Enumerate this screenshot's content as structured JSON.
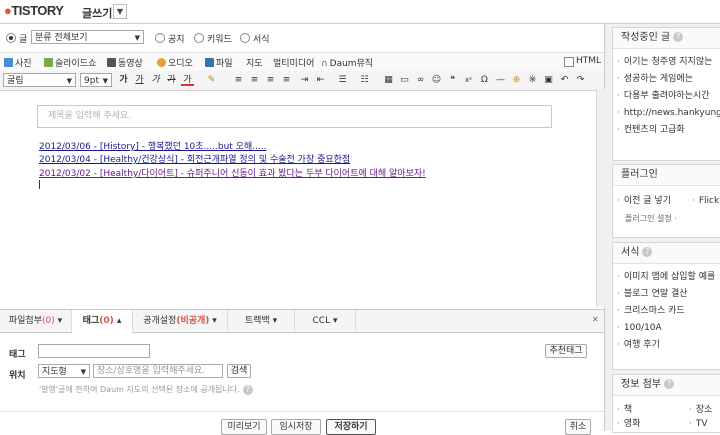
{
  "app": {
    "logo": "TISTORY",
    "subtitle": "글쓰기",
    "dropdown": "▼"
  },
  "category": {
    "radio_category_label": "글",
    "select_value": "분류 전체보기",
    "radio_notice": "공지",
    "radio_keyword": "키워드",
    "radio_form": "서식"
  },
  "attach_bar": {
    "photo": "사진",
    "slideshow": "슬라이드쇼",
    "video": "동영상",
    "audio": "오디오",
    "file": "파일",
    "map": "지도",
    "multimedia": "멀티미디어",
    "daum_music": "Daum뮤직",
    "html_label": "HTML"
  },
  "format_bar": {
    "font": "굴림",
    "size": "9pt",
    "bold": "가",
    "underline": "가",
    "italic": "가",
    "strike": "가",
    "color": "가"
  },
  "editor": {
    "title_placeholder": "제목을 입력해 주세요.",
    "links": [
      {
        "text": "2012/03/06 - [History] - 행복했던 10초.....but 오해.....",
        "color": "#1a1a8e"
      },
      {
        "text": "2012/03/04 - [Healthy/건강상식] - 회전근개파열 정의 및 수술전 가장 중요한점",
        "color": "#1a1a8e"
      },
      {
        "text": "2012/03/02 - [Healthy/다이어트] - 슈퍼주니어 신동이 효과 봤다는 두부 다이어트에 대해 알아보자!",
        "color": "#6a1a8e"
      }
    ]
  },
  "bottom_tabs": {
    "file_attach": "파일첨부",
    "file_attach_count": "(0)",
    "tag": "태그",
    "tag_count": "(0)",
    "visibility": "공개설정",
    "visibility_value": "(비공개)",
    "trackback": "트랙백",
    "ccl": "CCL"
  },
  "tag_section": {
    "tag_label": "태그",
    "location_label": "위치",
    "recommend_button": "추천태그",
    "map_select": "지도형",
    "place_placeholder": "장소/상호명을 입력해주세요.",
    "search_button": "검색",
    "notice": "'발행'글에 한하여 Daum 지도의 선택된 장소에 공개됩니다."
  },
  "actions": {
    "preview": "미리보기",
    "temp_save": "임시저장",
    "save": "저장하기",
    "cancel": "취소"
  },
  "sidebar": {
    "writing_title": "작성중인 글",
    "writing_items": [
      "이기는 청주영 지지않는",
      "성공하는 게임에는",
      "다용부 출려야하는시간",
      "http://news.hankyung",
      "컨텐츠의 고급화"
    ],
    "plugin_title": "플러그인",
    "plugin_items": [
      "이전 글 넣기",
      "Flickr"
    ],
    "plugin_settings": "플러그인 설정",
    "form_title": "서식",
    "form_items": [
      "이미지 맵에 삽입할 예를",
      "블로그 연말 결산",
      "크리스마스 카드",
      "100/10A",
      "여행 후기"
    ],
    "info_title": "정보 첨부",
    "info_items": [
      "책",
      "장소",
      "영화",
      "TV"
    ]
  },
  "colors": {
    "accent": "#e4572e",
    "link": "#1a1a8e",
    "visited": "#6a1a8e",
    "highlight": "#d9534f"
  }
}
